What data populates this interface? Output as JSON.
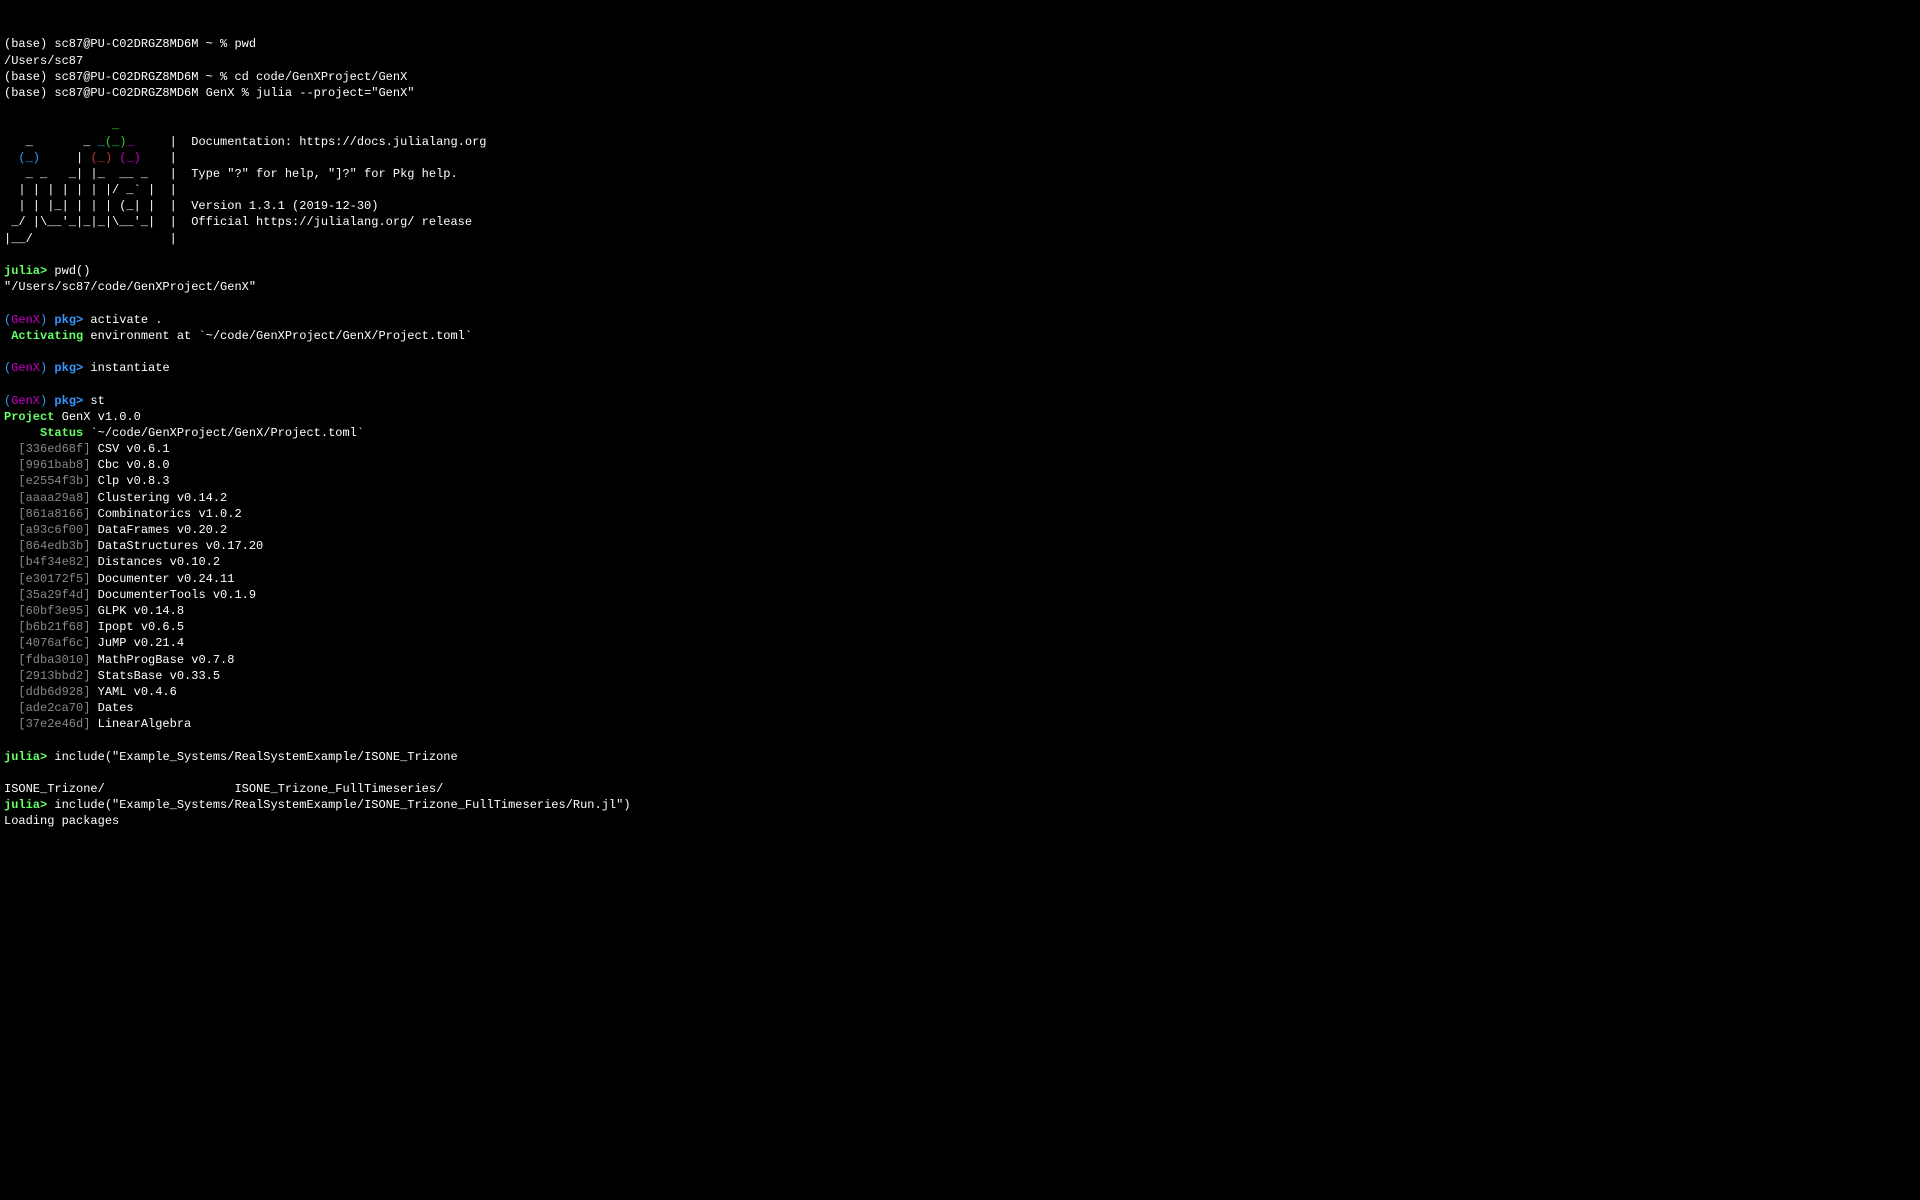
{
  "shell": {
    "prompt1": "(base) sc87@PU-C02DRGZ8MD6M ~ % ",
    "cmd1": "pwd",
    "out1": "/Users/sc87",
    "prompt2": "(base) sc87@PU-C02DRGZ8MD6M ~ % ",
    "cmd2": "cd code/GenXProject/GenX",
    "prompt3": "(base) sc87@PU-C02DRGZ8MD6M GenX % ",
    "cmd3": "julia --project=\"GenX\""
  },
  "banner": {
    "l1a": "               ",
    "l1b": "_",
    "l2a": "   _       _ ",
    "l2b": "_",
    "l2c": "(_)",
    "l2d": "_",
    "l2e": "     |  Documentation: https://docs.julialang.org",
    "l3a": "  ",
    "l3b": "(_)",
    "l3c": "     | ",
    "l3d": "(_)",
    "l3e": " ",
    "l3f": "(_)",
    "l3g": "    |",
    "l4a": "   _ _   _| |_  __ _   |  Type \"?\" for help, \"]?\" for Pkg help.",
    "l5a": "  | | | | | | |/ _` |  |",
    "l6a": "  | | |_| | | | (_| |  |  Version 1.3.1 (2019-12-30)",
    "l7a": " _/ |\\__'_|_|_|\\__'_|  |  Official https://julialang.org/ release",
    "l8a": "|__/                   |"
  },
  "repl": {
    "juliaPrompt": "julia>",
    "cmd_pwd": " pwd()",
    "out_pwd": "\"/Users/sc87/code/GenXProject/GenX\"",
    "pkgPrompt_open": "(",
    "pkgPrompt_name": "GenX",
    "pkgPrompt_close": ") ",
    "pkgPrefix": "pkg>",
    "cmd_activate": " activate .",
    "activating_label": " Activating",
    "activating_rest": " environment at `~/code/GenXProject/GenX/Project.toml`",
    "cmd_instantiate": " instantiate",
    "cmd_st": " st",
    "project_label": "Project",
    "project_rest": " GenX v1.0.0",
    "status_label": "Status",
    "status_rest": " `~/code/GenXProject/GenX/Project.toml`",
    "packages": [
      {
        "id": "  [336ed68f]",
        "rest": " CSV v0.6.1"
      },
      {
        "id": "  [9961bab8]",
        "rest": " Cbc v0.8.0"
      },
      {
        "id": "  [e2554f3b]",
        "rest": " Clp v0.8.3"
      },
      {
        "id": "  [aaaa29a8]",
        "rest": " Clustering v0.14.2"
      },
      {
        "id": "  [861a8166]",
        "rest": " Combinatorics v1.0.2"
      },
      {
        "id": "  [a93c6f00]",
        "rest": " DataFrames v0.20.2"
      },
      {
        "id": "  [864edb3b]",
        "rest": " DataStructures v0.17.20"
      },
      {
        "id": "  [b4f34e82]",
        "rest": " Distances v0.10.2"
      },
      {
        "id": "  [e30172f5]",
        "rest": " Documenter v0.24.11"
      },
      {
        "id": "  [35a29f4d]",
        "rest": " DocumenterTools v0.1.9"
      },
      {
        "id": "  [60bf3e95]",
        "rest": " GLPK v0.14.8"
      },
      {
        "id": "  [b6b21f68]",
        "rest": " Ipopt v0.6.5"
      },
      {
        "id": "  [4076af6c]",
        "rest": " JuMP v0.21.4"
      },
      {
        "id": "  [fdba3010]",
        "rest": " MathProgBase v0.7.8"
      },
      {
        "id": "  [2913bbd2]",
        "rest": " StatsBase v0.33.5"
      },
      {
        "id": "  [ddb6d928]",
        "rest": " YAML v0.4.6"
      },
      {
        "id": "  [ade2ca70]",
        "rest": " Dates "
      },
      {
        "id": "  [37e2e46d]",
        "rest": " LinearAlgebra "
      }
    ],
    "cmd_include1": " include(\"Example_Systems/RealSystemExample/ISONE_Trizone",
    "tab1": "ISONE_Trizone/                  ISONE_Trizone_FullTimeseries/",
    "cmd_include2": " include(\"Example_Systems/RealSystemExample/ISONE_Trizone_FullTimeseries/Run.jl\")",
    "loading": "Loading packages"
  }
}
